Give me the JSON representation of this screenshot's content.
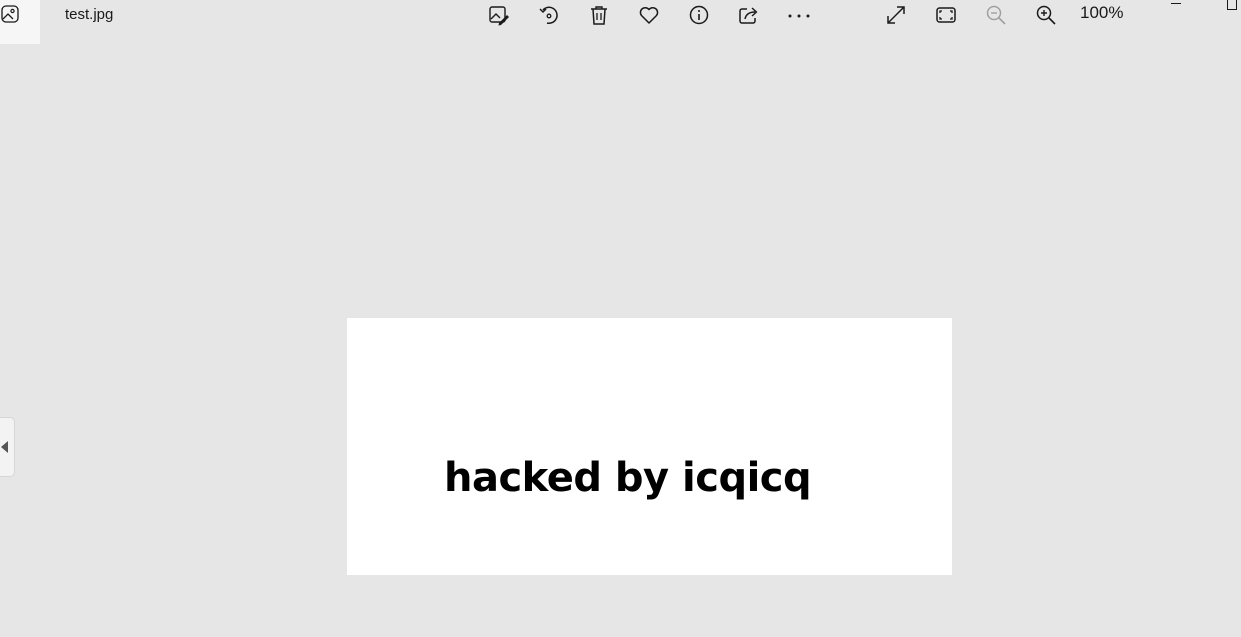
{
  "window": {
    "file_name": "test.jpg"
  },
  "toolbar": {
    "items": [
      {
        "name": "edit-image",
        "icon": "edit-image-icon"
      },
      {
        "name": "rotate",
        "icon": "rotate-icon"
      },
      {
        "name": "delete",
        "icon": "trash-icon"
      },
      {
        "name": "favorite",
        "icon": "heart-icon"
      },
      {
        "name": "file-info",
        "icon": "info-icon"
      },
      {
        "name": "share",
        "icon": "share-icon"
      },
      {
        "name": "more",
        "icon": "more-icon"
      }
    ],
    "view_controls": [
      {
        "name": "fullscreen",
        "icon": "expand-icon"
      },
      {
        "name": "fit-to-window",
        "icon": "fit-icon"
      },
      {
        "name": "zoom-out",
        "icon": "zoom-out-icon",
        "enabled": false
      },
      {
        "name": "zoom-in",
        "icon": "zoom-in-icon",
        "enabled": true
      }
    ],
    "zoom_level": "100%"
  },
  "image": {
    "text": "hacked by icqicq",
    "background_color": "#ffffff",
    "text_color": "#000000"
  },
  "colors": {
    "app_background": "#e6e6e6",
    "icon_color": "#1a1a1a",
    "disabled_icon_color": "#a0a0a0"
  }
}
